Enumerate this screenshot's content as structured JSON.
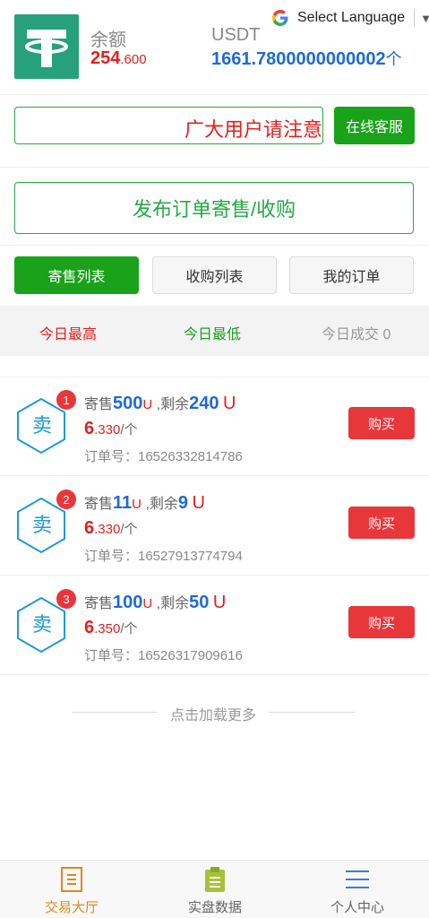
{
  "header": {
    "balance_label": "余额",
    "balance_int": "254",
    "balance_dec": ".600",
    "usdt_label": "USDT",
    "usdt_value": "1661.7800000000002",
    "usdt_unit": "个",
    "language_label": "Select Language"
  },
  "notice": {
    "text": "广大用户请注意",
    "service_label": "在线客服"
  },
  "publish_label": "发布订单寄售/收购",
  "tabs": [
    {
      "label": "寄售列表",
      "active": true
    },
    {
      "label": "收购列表",
      "active": false
    },
    {
      "label": "我的订单",
      "active": false
    }
  ],
  "stats": {
    "high": "今日最高",
    "low": "今日最低",
    "deals": "今日成交 0"
  },
  "orders": [
    {
      "rank": "1",
      "hex_label": "卖",
      "sell_prefix": "寄售",
      "sell_amount": "500",
      "sell_unit": "U",
      "remain_prefix": " ,剩余",
      "remain_amount": "240",
      "remain_unit": "U",
      "price_int": "6",
      "price_dec": ".330",
      "price_unit": "/个",
      "order_label": "订单号：16526332814786",
      "buy_label": "购买"
    },
    {
      "rank": "2",
      "hex_label": "卖",
      "sell_prefix": "寄售",
      "sell_amount": "11",
      "sell_unit": "U",
      "remain_prefix": " ,剩余",
      "remain_amount": "9",
      "remain_unit": "U",
      "price_int": "6",
      "price_dec": ".330",
      "price_unit": "/个",
      "order_label": "订单号：16527913774794",
      "buy_label": "购买"
    },
    {
      "rank": "3",
      "hex_label": "卖",
      "sell_prefix": "寄售",
      "sell_amount": "100",
      "sell_unit": "U",
      "remain_prefix": " ,剩余",
      "remain_amount": "50",
      "remain_unit": "U",
      "price_int": "6",
      "price_dec": ".350",
      "price_unit": "/个",
      "order_label": "订单号：16526317909616",
      "buy_label": "购买"
    }
  ],
  "load_more": "点击加载更多",
  "nav": [
    {
      "label": "交易大厅",
      "icon": "document-list-icon",
      "active": true
    },
    {
      "label": "实盘数据",
      "icon": "clipboard-icon",
      "active": false
    },
    {
      "label": "个人中心",
      "icon": "menu-lines-icon",
      "active": false
    }
  ],
  "colors": {
    "accent_green": "#1aa21a",
    "price_red": "#e02020",
    "value_blue": "#1e6ad6",
    "buy_red": "#e8373b",
    "tether_green": "#26a17b",
    "nav_active": "#e0871b"
  }
}
